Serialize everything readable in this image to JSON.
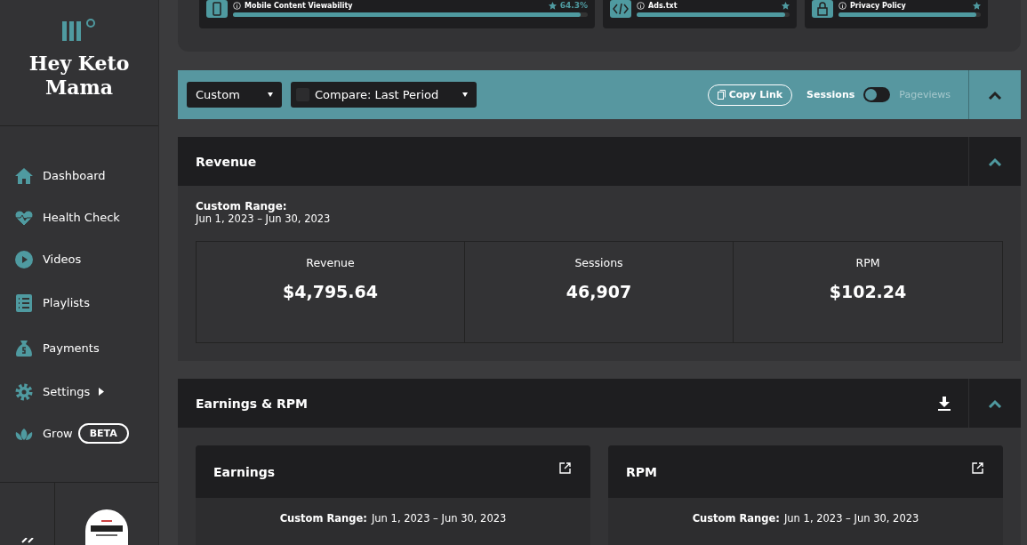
{
  "sidebar": {
    "brand": "Hey Keto Mama",
    "items": [
      {
        "label": "Dashboard"
      },
      {
        "label": "Health Check"
      },
      {
        "label": "Videos"
      },
      {
        "label": "Playlists"
      },
      {
        "label": "Payments"
      },
      {
        "label": "Settings",
        "submenu": true
      },
      {
        "label": "Grow",
        "badge": "BETA"
      }
    ]
  },
  "health_cards": [
    {
      "title": "Mobile Content Viewability",
      "score": "64.3%",
      "level": 0.98
    },
    {
      "title": "Ads.txt",
      "level": 0.97
    },
    {
      "title": "Privacy Policy",
      "level": 0.97
    }
  ],
  "filter_bar": {
    "range": "Custom",
    "compare": {
      "label": "Compare: Last Period",
      "checked": false
    },
    "copy_link": "Copy Link",
    "toggle": {
      "left": "Sessions",
      "right": "Pageviews",
      "on": false
    }
  },
  "revenue": {
    "title": "Revenue",
    "range_label": "Custom Range:",
    "range": "Jun 1, 2023 – Jun 30, 2023",
    "stats": [
      {
        "label": "Revenue",
        "value": "$4,795.64"
      },
      {
        "label": "Sessions",
        "value": "46,907"
      },
      {
        "label": "RPM",
        "value": "$102.24"
      }
    ]
  },
  "earnings_rpm": {
    "title": "Earnings & RPM",
    "cards": [
      {
        "title": "Earnings",
        "range_label": "Custom Range:",
        "range": "Jun 1, 2023 – Jun 30, 2023"
      },
      {
        "title": "RPM",
        "range_label": "Custom Range:",
        "range": "Jun 1, 2023 – Jun 30, 2023"
      }
    ]
  }
}
